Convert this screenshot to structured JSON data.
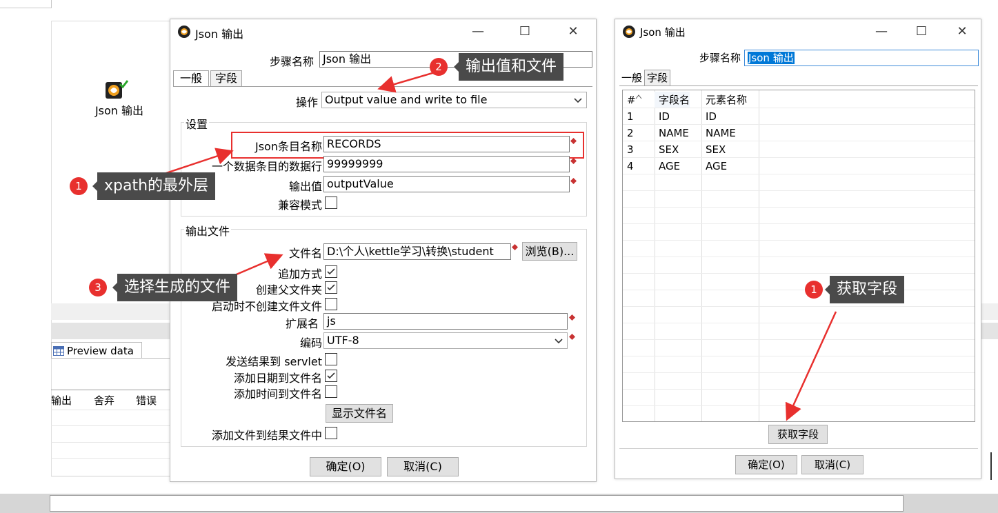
{
  "background": {
    "step_label": "Json 输出",
    "preview_tab": "Preview data",
    "table_columns": [
      "输出",
      "舍弃",
      "错误"
    ]
  },
  "left_dialog": {
    "title": "Json 输出",
    "step_name_label": "步骤名称",
    "step_name_value": "Json 输出",
    "tabs": [
      "一般",
      "字段"
    ],
    "operation_label": "操作",
    "operation_value": "Output value and write to file",
    "settings_group": "设置",
    "json_entry_label": "Json条目名称",
    "json_entry_value": "RECORDS",
    "rows_label": "一个数据条目的数据行",
    "rows_value": "99999999",
    "output_value_label": "输出值",
    "output_value_value": "outputValue",
    "compat_label": "兼容模式",
    "output_file_group": "输出文件",
    "filename_label": "文件名",
    "filename_value": "D:\\个人\\kettle学习\\转换\\student",
    "browse_button": "浏览(B)...",
    "append_label": "追加方式",
    "create_parent_label": "创建父文件夹",
    "no_create_label": "启动时不创建文件文件",
    "extension_label": "扩展名",
    "extension_value": "js",
    "encoding_label": "编码",
    "encoding_value": "UTF-8",
    "servlet_label": "发送结果到 servlet",
    "add_date_label": "添加日期到文件名",
    "add_time_label": "添加时间到文件名",
    "show_filename_button": "显示文件名",
    "add_to_result_label": "添加文件到结果文件中",
    "ok_button": "确定(O)",
    "cancel_button": "取消(C)"
  },
  "right_dialog": {
    "title": "Json 输出",
    "step_name_label": "步骤名称",
    "step_name_value": "Json 输出",
    "tabs": [
      "一般",
      "字段"
    ],
    "columns": [
      "#",
      "字段名",
      "元素名称"
    ],
    "rows": [
      {
        "num": "1",
        "field": "ID",
        "element": "ID"
      },
      {
        "num": "2",
        "field": "NAME",
        "element": "NAME"
      },
      {
        "num": "3",
        "field": "SEX",
        "element": "SEX"
      },
      {
        "num": "4",
        "field": "AGE",
        "element": "AGE"
      }
    ],
    "get_fields_button": "获取字段",
    "ok_button": "确定(O)",
    "cancel_button": "取消(C)"
  },
  "annotations": {
    "a1_num": "1",
    "a1_text": "xpath的最外层",
    "a2_num": "2",
    "a2_text": "输出值和文件",
    "a3_num": "3",
    "a3_text": "选择生成的文件",
    "b1_num": "1",
    "b1_text": "获取字段"
  },
  "colors": {
    "annotation_red": "#e8302e",
    "callout_bg": "#4a4a4a",
    "selection_blue": "#0078d7"
  }
}
